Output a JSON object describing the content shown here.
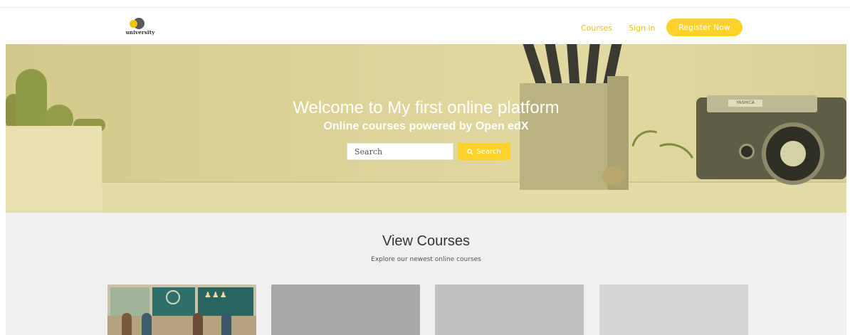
{
  "header": {
    "logo_text": "university",
    "nav": {
      "courses_label": "Courses",
      "signin_label": "Sign in",
      "register_label": "Register Now"
    }
  },
  "hero": {
    "title": "Welcome to My first online platform",
    "subtitle": "Online courses powered by Open edX",
    "search": {
      "placeholder": "Search",
      "value": "",
      "button_label": "Search",
      "button_icon": "search-icon"
    },
    "camera_label": "YASHICA"
  },
  "courses": {
    "title": "View Courses",
    "subtitle": "Explore our newest online courses",
    "cards": [
      {
        "image": "illustrated-course-thumbnail"
      },
      {
        "image": "placeholder"
      },
      {
        "image": "placeholder"
      },
      {
        "image": "placeholder"
      }
    ]
  },
  "colors": {
    "accent": "#fcd22a",
    "link": "#e8c315",
    "hero_tint": "#d8cf8e",
    "section_bg": "#f0f0f0"
  }
}
